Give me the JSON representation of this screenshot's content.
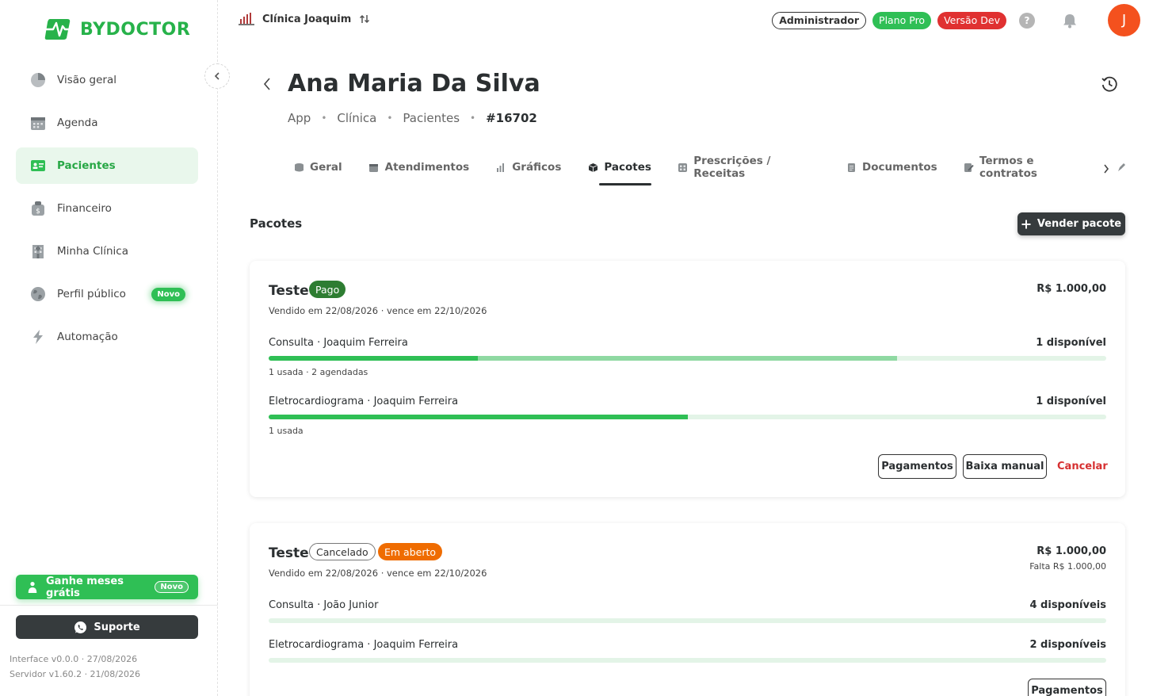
{
  "brand": {
    "name": "BYDOCTOR",
    "color": "#27b24a"
  },
  "sidebar": {
    "items": [
      {
        "label": "Visão geral",
        "icon": "pie-chart-icon",
        "active": false
      },
      {
        "label": "Agenda",
        "icon": "calendar-icon",
        "active": false
      },
      {
        "label": "Pacientes",
        "icon": "id-card-icon",
        "active": true
      },
      {
        "label": "Financeiro",
        "icon": "money-bag-icon",
        "active": false
      },
      {
        "label": "Minha Clínica",
        "icon": "building-icon",
        "active": false
      },
      {
        "label": "Perfil público",
        "icon": "globe-icon",
        "active": false,
        "badge": "Novo"
      },
      {
        "label": "Automação",
        "icon": "lightning-icon",
        "active": false
      }
    ],
    "promo": {
      "label": "Ganhe meses grátis",
      "badge": "Novo"
    },
    "support_label": "Suporte",
    "interface_version": "Interface v0.0.0 · 27/08/2026",
    "server_version": "Servidor v1.60.2 · 21/08/2026"
  },
  "topbar": {
    "clinic_name": "Clínica Joaquim",
    "role": "Administrador",
    "plan": "Plano Pro",
    "env": "Versão Dev",
    "help": "?",
    "avatar_initial": "J",
    "avatar_color": "#f4511e"
  },
  "header": {
    "title": "Ana Maria Da Silva",
    "breadcrumb": [
      "App",
      "Clínica",
      "Pacientes",
      "#16702"
    ]
  },
  "tabs": [
    {
      "label": "Geral",
      "icon": "database-icon",
      "active": false
    },
    {
      "label": "Atendimentos",
      "icon": "calendar-icon",
      "active": false
    },
    {
      "label": "Gráficos",
      "icon": "bar-chart-icon",
      "active": false
    },
    {
      "label": "Pacotes",
      "icon": "package-icon",
      "active": true
    },
    {
      "label": "Prescrições / Receitas",
      "icon": "prescription-icon",
      "active": false
    },
    {
      "label": "Documentos",
      "icon": "document-icon",
      "active": false
    },
    {
      "label": "Termos e contratos",
      "icon": "contract-icon",
      "active": false
    }
  ],
  "section": {
    "title": "Pacotes",
    "sell_button": "Vender pacote"
  },
  "packages": [
    {
      "name": "Teste",
      "statuses": [
        "Pago"
      ],
      "sold_line": "Vendido em 22/08/2026 · vence em 22/10/2026",
      "price": "R$ 1.000,00",
      "services": [
        {
          "name": "Consulta · Joaquim Ferreira",
          "available": "1 disponível",
          "usage": "1 usada · 2 agendadas",
          "used_fraction": 0.25,
          "scheduled_fraction": 0.5
        },
        {
          "name": "Eletrocardiograma · Joaquim Ferreira",
          "available": "1 disponível",
          "usage": "1 usada",
          "used_fraction": 0.5,
          "scheduled_fraction": 0
        }
      ],
      "actions": {
        "payments": "Pagamentos",
        "manual": "Baixa manual",
        "cancel": "Cancelar"
      }
    },
    {
      "name": "Teste",
      "statuses": [
        "Cancelado",
        "Em aberto"
      ],
      "sold_line": "Vendido em 22/08/2026 · vence em 22/10/2026",
      "price": "R$ 1.000,00",
      "due": "Falta R$ 1.000,00",
      "services": [
        {
          "name": "Consulta · João Junior",
          "available": "4 disponíveis",
          "used_fraction": 0,
          "scheduled_fraction": 0
        },
        {
          "name": "Eletrocardiograma · Joaquim Ferreira",
          "available": "2 disponíveis",
          "used_fraction": 0,
          "scheduled_fraction": 0
        }
      ],
      "actions": {
        "payments": "Pagamentos"
      }
    }
  ]
}
